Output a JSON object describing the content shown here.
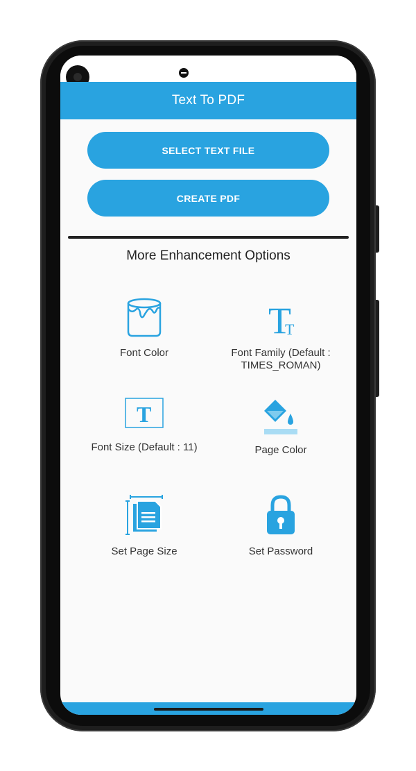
{
  "app": {
    "title": "Text To PDF"
  },
  "actions": {
    "select_text_file": "SELECT TEXT FILE",
    "create_pdf": "CREATE PDF"
  },
  "section": {
    "title": "More Enhancement Options"
  },
  "options": [
    {
      "label": "Font Color",
      "icon": "paint-bucket-icon"
    },
    {
      "label": "Font Family (Default : TIMES_ROMAN)",
      "icon": "font-family-icon"
    },
    {
      "label": "Font Size (Default : 11)",
      "icon": "font-size-icon"
    },
    {
      "label": "Page Color",
      "icon": "page-color-icon"
    },
    {
      "label": "Set Page Size",
      "icon": "page-size-icon"
    },
    {
      "label": "Set Password",
      "icon": "lock-icon"
    }
  ],
  "colors": {
    "accent": "#29a3e0",
    "text": "#333333"
  }
}
